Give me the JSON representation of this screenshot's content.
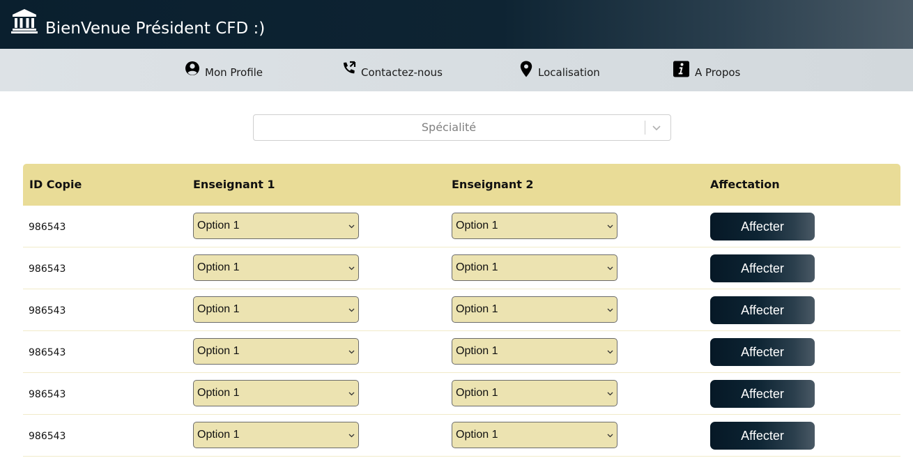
{
  "header": {
    "title": "BienVenue Président CFD :)",
    "logo_icon": "bank-building-icon"
  },
  "nav": {
    "items": [
      {
        "label": "Mon Profile",
        "icon": "user-circle-icon"
      },
      {
        "label": "Contactez-nous",
        "icon": "phone-icon"
      },
      {
        "label": "Localisation",
        "icon": "map-pin-icon"
      },
      {
        "label": "A Propos",
        "icon": "info-icon"
      }
    ]
  },
  "specialite_select": {
    "placeholder": "Spécialité",
    "icon": "chevron-down-icon"
  },
  "table": {
    "headers": [
      "ID Copie",
      "Enseignant 1",
      "Enseignant 2",
      "Affectation"
    ],
    "rows": [
      {
        "id": "986543",
        "enseignant1": "Option 1",
        "enseignant2": "Option 1",
        "action": "Affecter"
      },
      {
        "id": "986543",
        "enseignant1": "Option 1",
        "enseignant2": "Option 1",
        "action": "Affecter"
      },
      {
        "id": "986543",
        "enseignant1": "Option 1",
        "enseignant2": "Option 1",
        "action": "Affecter"
      },
      {
        "id": "986543",
        "enseignant1": "Option 1",
        "enseignant2": "Option 1",
        "action": "Affecter"
      },
      {
        "id": "986543",
        "enseignant1": "Option 1",
        "enseignant2": "Option 1",
        "action": "Affecter"
      },
      {
        "id": "986543",
        "enseignant1": "Option 1",
        "enseignant2": "Option 1",
        "action": "Affecter"
      }
    ]
  },
  "colors": {
    "header_dark": "#0a1f2e",
    "nav_bg": "#d7dde1",
    "table_header_bg": "#e9dc97",
    "dropdown_bg": "#ece3b1"
  }
}
